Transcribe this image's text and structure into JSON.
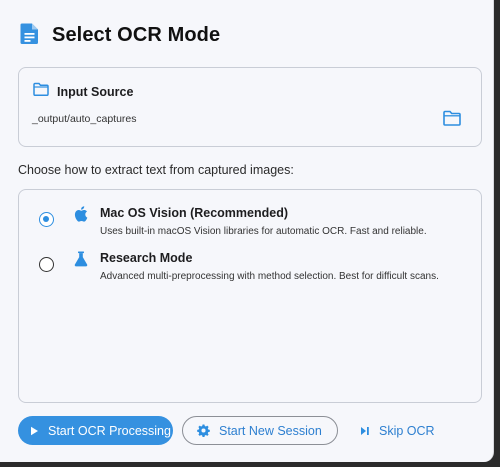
{
  "dialog": {
    "title": "Select OCR Mode"
  },
  "input_source": {
    "label": "Input Source",
    "path": "_output/auto_captures"
  },
  "prompt": "Choose how to extract text from captured images:",
  "modes": [
    {
      "title": "Mac OS Vision (Recommended)",
      "description": "Uses built-in macOS Vision libraries for automatic OCR. Fast and reliable.",
      "selected": true,
      "icon": "apple-icon"
    },
    {
      "title": "Research Mode",
      "description": "Advanced multi-preprocessing with method selection. Best for difficult scans.",
      "selected": false,
      "icon": "flask-icon"
    }
  ],
  "actions": {
    "start_ocr_label": "Start OCR Processing",
    "new_session_label": "Start New Session",
    "skip_label": "Skip OCR"
  },
  "colors": {
    "accent": "#3591e0",
    "link": "#2d7fd0",
    "background": "#f6f7fb"
  }
}
